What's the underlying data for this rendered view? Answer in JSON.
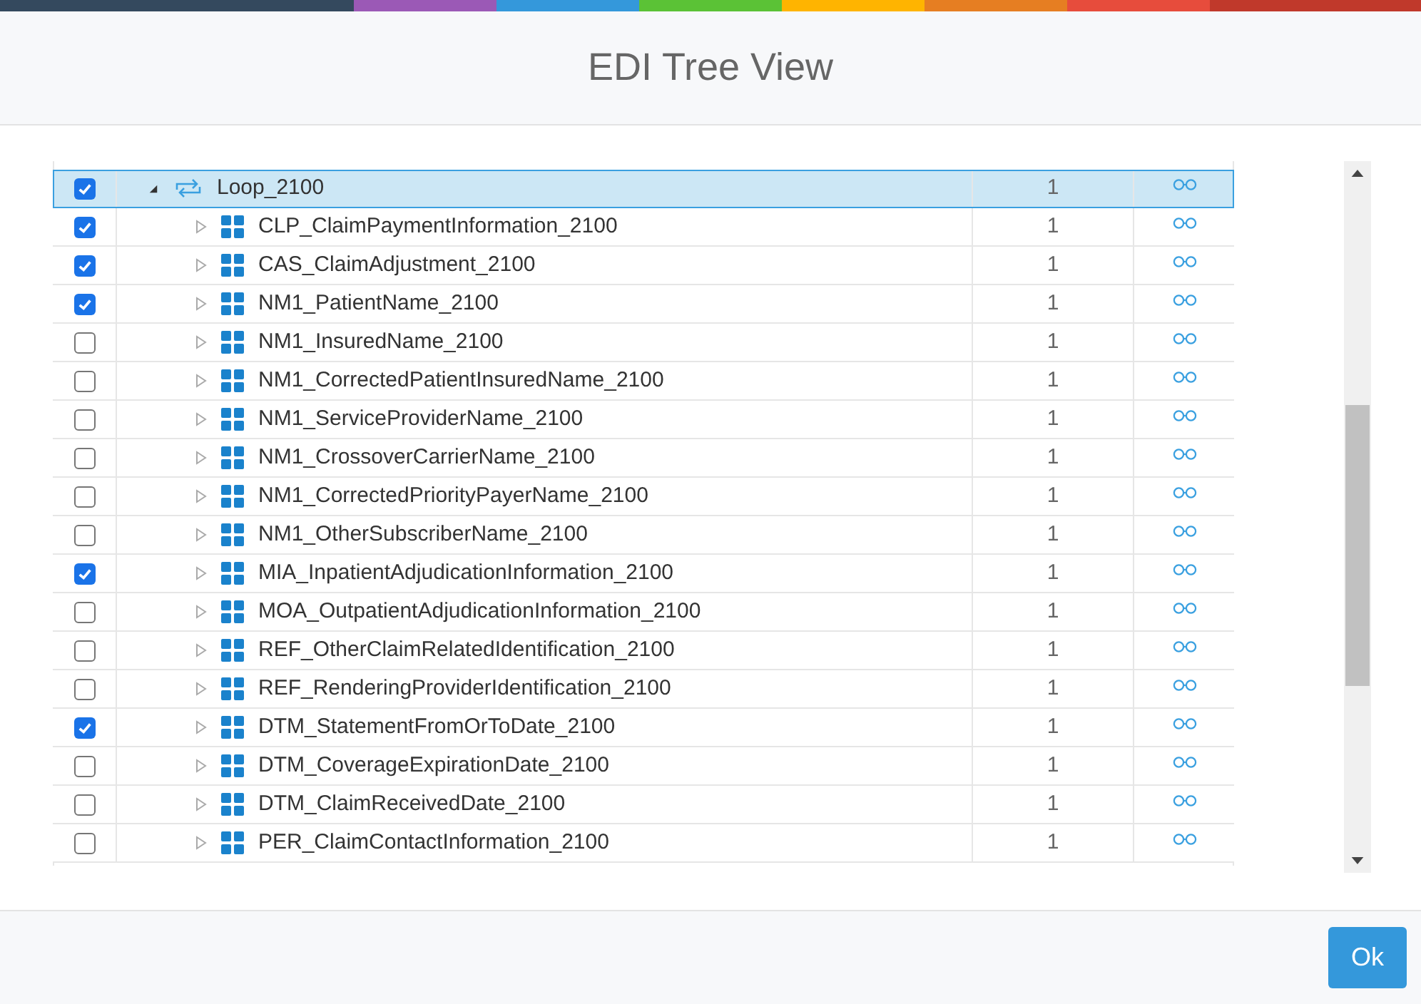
{
  "dialog": {
    "title": "EDI Tree View"
  },
  "tree": [
    {
      "name": "Loop_2100",
      "kind": "loop",
      "checked": true,
      "expanded": true,
      "selected": true,
      "count": "1",
      "children": [
        {
          "name": "CLP_ClaimPaymentInformation_2100",
          "kind": "segment",
          "checked": true,
          "expanded": false,
          "selected": false,
          "count": "1"
        },
        {
          "name": "CAS_ClaimAdjustment_2100",
          "kind": "segment",
          "checked": true,
          "expanded": false,
          "selected": false,
          "count": "1"
        },
        {
          "name": "NM1_PatientName_2100",
          "kind": "segment",
          "checked": true,
          "expanded": false,
          "selected": false,
          "count": "1"
        },
        {
          "name": "NM1_InsuredName_2100",
          "kind": "segment",
          "checked": false,
          "expanded": false,
          "selected": false,
          "count": "1"
        },
        {
          "name": "NM1_CorrectedPatientInsuredName_2100",
          "kind": "segment",
          "checked": false,
          "expanded": false,
          "selected": false,
          "count": "1"
        },
        {
          "name": "NM1_ServiceProviderName_2100",
          "kind": "segment",
          "checked": false,
          "expanded": false,
          "selected": false,
          "count": "1"
        },
        {
          "name": "NM1_CrossoverCarrierName_2100",
          "kind": "segment",
          "checked": false,
          "expanded": false,
          "selected": false,
          "count": "1"
        },
        {
          "name": "NM1_CorrectedPriorityPayerName_2100",
          "kind": "segment",
          "checked": false,
          "expanded": false,
          "selected": false,
          "count": "1"
        },
        {
          "name": "NM1_OtherSubscriberName_2100",
          "kind": "segment",
          "checked": false,
          "expanded": false,
          "selected": false,
          "count": "1"
        },
        {
          "name": "MIA_InpatientAdjudicationInformation_2100",
          "kind": "segment",
          "checked": true,
          "expanded": false,
          "selected": false,
          "count": "1"
        },
        {
          "name": "MOA_OutpatientAdjudicationInformation_2100",
          "kind": "segment",
          "checked": false,
          "expanded": false,
          "selected": false,
          "count": "1"
        },
        {
          "name": "REF_OtherClaimRelatedIdentification_2100",
          "kind": "segment",
          "checked": false,
          "expanded": false,
          "selected": false,
          "count": "1"
        },
        {
          "name": "REF_RenderingProviderIdentification_2100",
          "kind": "segment",
          "checked": false,
          "expanded": false,
          "selected": false,
          "count": "1"
        },
        {
          "name": "DTM_StatementFromOrToDate_2100",
          "kind": "segment",
          "checked": true,
          "expanded": false,
          "selected": false,
          "count": "1"
        },
        {
          "name": "DTM_CoverageExpirationDate_2100",
          "kind": "segment",
          "checked": false,
          "expanded": false,
          "selected": false,
          "count": "1"
        },
        {
          "name": "DTM_ClaimReceivedDate_2100",
          "kind": "segment",
          "checked": false,
          "expanded": false,
          "selected": false,
          "count": "1"
        },
        {
          "name": "PER_ClaimContactInformation_2100",
          "kind": "segment",
          "checked": false,
          "expanded": false,
          "selected": false,
          "count": "1"
        }
      ]
    }
  ],
  "buttons": [
    {
      "label": "Ok"
    }
  ]
}
